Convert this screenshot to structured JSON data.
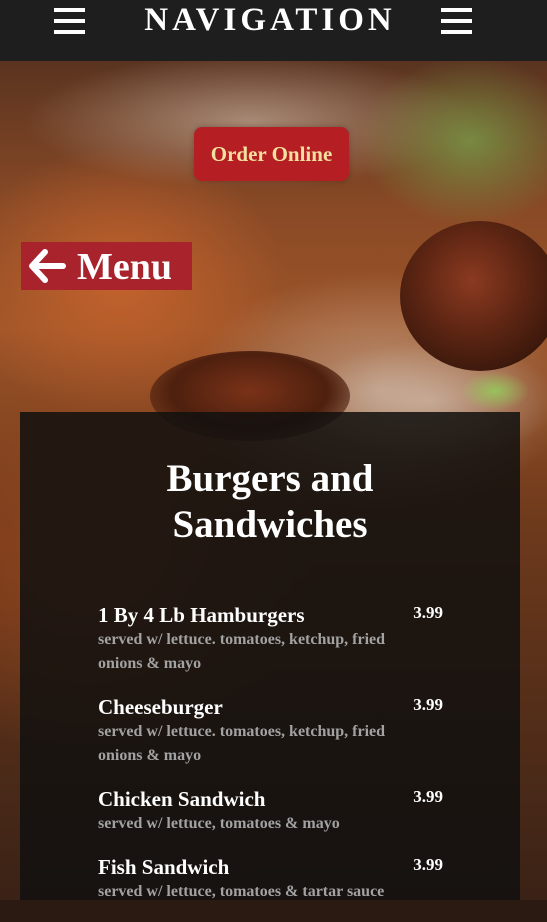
{
  "navbar": {
    "title": "NAVIGATION",
    "left_icon": "hamburger-menu-icon",
    "right_icon": "hamburger-menu-icon"
  },
  "order": {
    "label": "Order Online"
  },
  "back": {
    "label": "Menu",
    "icon": "arrow-left-icon"
  },
  "section": {
    "title_line1": "Burgers and",
    "title_line2": "Sandwiches"
  },
  "items": [
    {
      "name": "1 By 4 Lb Hamburgers",
      "price": "3.99",
      "description": "served w/ lettuce. tomatoes, ketchup, fried onions & mayo"
    },
    {
      "name": "Cheeseburger",
      "price": "3.99",
      "description": "served w/ lettuce. tomatoes, ketchup, fried onions & mayo"
    },
    {
      "name": "Chicken Sandwich",
      "price": "3.99",
      "description": "served w/ lettuce, tomatoes & mayo"
    },
    {
      "name": "Fish Sandwich",
      "price": "3.99",
      "description": "served w/ lettuce, tomatoes & tartar sauce"
    }
  ],
  "colors": {
    "navbar_bg": "#1e1e1e",
    "accent_red": "#b51f23",
    "order_text": "#f3dfa0",
    "panel_bg": "#12100f",
    "desc_text": "#a2a2a2"
  }
}
